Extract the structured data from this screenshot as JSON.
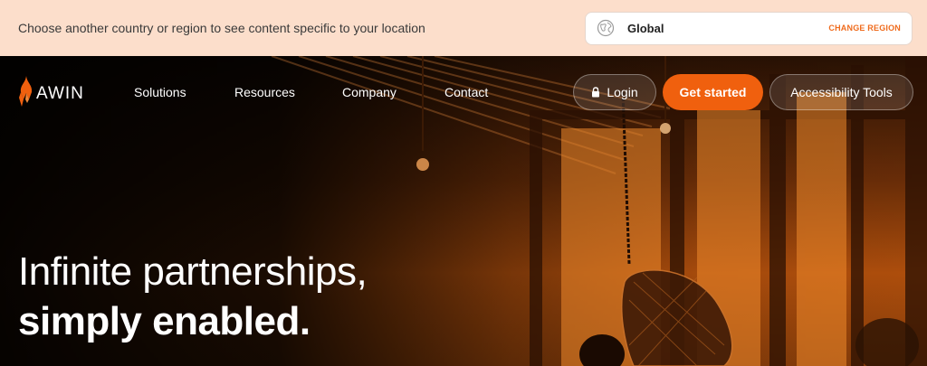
{
  "region_bar": {
    "message": "Choose another country or region to see content specific to your location",
    "selected_region": "Global",
    "change_label": "CHANGE REGION"
  },
  "nav": {
    "logo_text": "AWIN",
    "links": [
      "Solutions",
      "Resources",
      "Company",
      "Contact"
    ],
    "login_label": "Login",
    "get_started_label": "Get started",
    "accessibility_label": "Accessibility Tools"
  },
  "hero": {
    "title_line1": "Infinite partnerships,",
    "title_line2": "simply enabled."
  },
  "colors": {
    "accent": "#f0600e",
    "banner_bg": "#fcdecb",
    "change_region": "#ef6b1d"
  }
}
